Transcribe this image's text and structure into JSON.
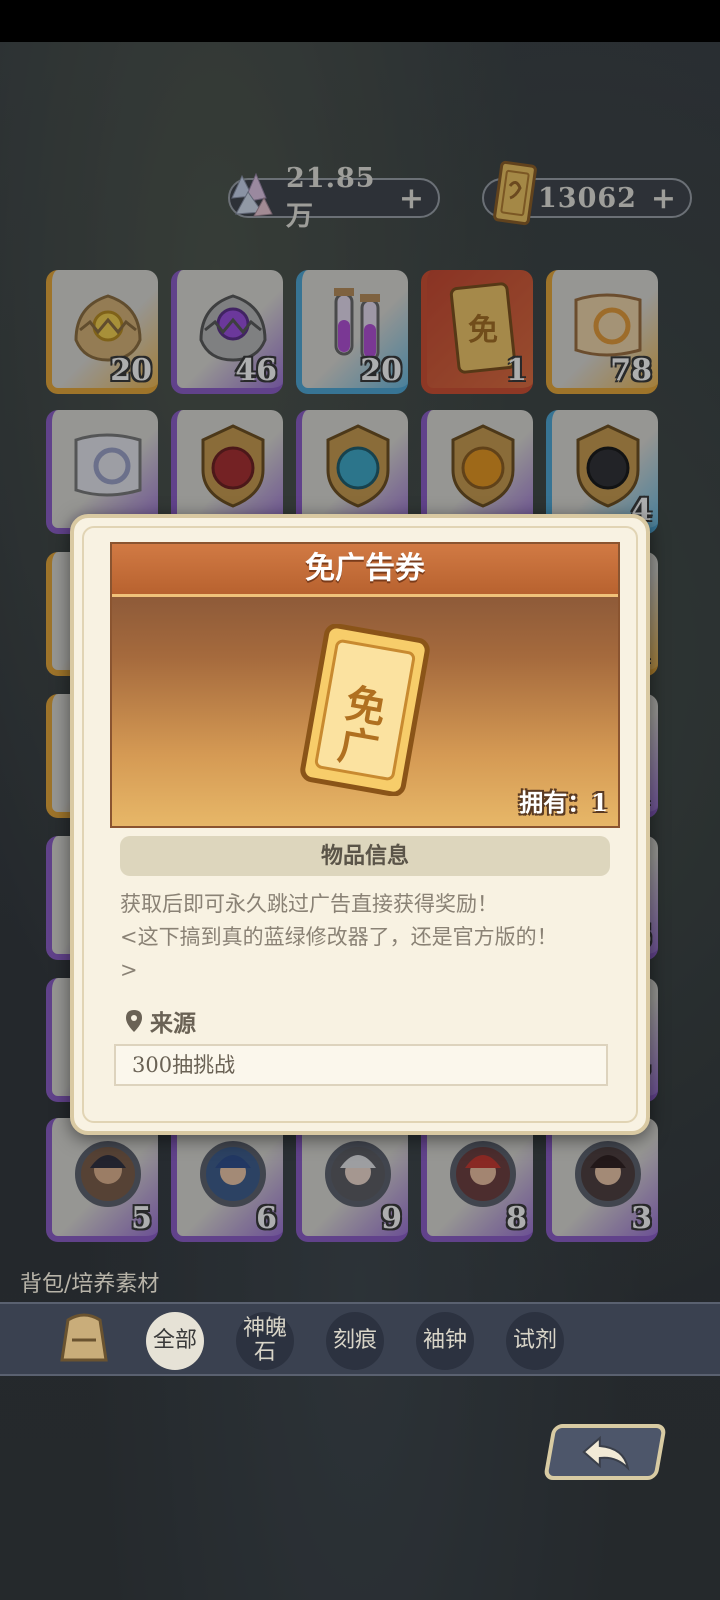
{
  "currency": {
    "crystal": {
      "value": "21.85万",
      "plus": "+",
      "icon": "crystal-icon"
    },
    "ticket": {
      "value": "13062",
      "plus": "+",
      "icon": "ticket-icon"
    }
  },
  "grid_rows": [
    {
      "tiles": [
        {
          "count": "20",
          "rarity": "gold",
          "icon": "gold-egg-icon"
        },
        {
          "count": "46",
          "rarity": "purple",
          "icon": "purple-egg-icon"
        },
        {
          "count": "20",
          "rarity": "blue",
          "icon": "potion-vials-icon"
        },
        {
          "count": "1",
          "rarity": "red",
          "icon": "ad-free-ticket-icon"
        },
        {
          "count": "78",
          "rarity": "gold",
          "icon": "scroll-icon"
        }
      ]
    },
    {
      "tiles": [
        {
          "count": "",
          "rarity": "purple",
          "icon": "scroll-icon"
        },
        {
          "count": "",
          "rarity": "purple",
          "icon": "red-badge-icon"
        },
        {
          "count": "",
          "rarity": "purple",
          "icon": "blue-badge-icon"
        },
        {
          "count": "",
          "rarity": "purple",
          "icon": "orange-badge-icon"
        },
        {
          "count": "4",
          "rarity": "blue",
          "icon": "dark-badge-icon"
        }
      ]
    },
    {
      "partial_counts_right": [
        "1",
        "1",
        "6",
        "7"
      ]
    },
    {
      "tiles": [
        {
          "count": "5",
          "rarity": "purple",
          "icon": "character-frame-icon"
        },
        {
          "count": "6",
          "rarity": "purple",
          "icon": "character-frame-icon"
        },
        {
          "count": "9",
          "rarity": "purple",
          "icon": "character-frame-icon"
        },
        {
          "count": "8",
          "rarity": "purple",
          "icon": "character-frame-icon"
        },
        {
          "count": "3",
          "rarity": "purple",
          "icon": "character-frame-icon"
        }
      ]
    }
  ],
  "breadcrumb": "背包/培养素材",
  "tabs": [
    {
      "label": "全部",
      "active": true
    },
    {
      "label": "神魄\n石",
      "active": false
    },
    {
      "label": "刻痕",
      "active": false
    },
    {
      "label": "袖钟",
      "active": false
    },
    {
      "label": "试剂",
      "active": false
    }
  ],
  "modal": {
    "title": "免广告券",
    "owned": "拥有：1",
    "info_header": "物品信息",
    "desc_line1": "获取后即可永久跳过广告直接获得奖励！",
    "desc_line2": "<这下搞到真的蓝绿修改器了，还是官方版的！",
    "desc_line3": ">",
    "source_label": "来源",
    "source_value": "300抽挑战",
    "ticket_glyph": "免广"
  },
  "colors": {
    "gold": "#e9a634",
    "purple": "#8a5ac8",
    "blue": "#4aa6d6",
    "red": "#d04a2c",
    "banner_head": "#c96d3a"
  }
}
